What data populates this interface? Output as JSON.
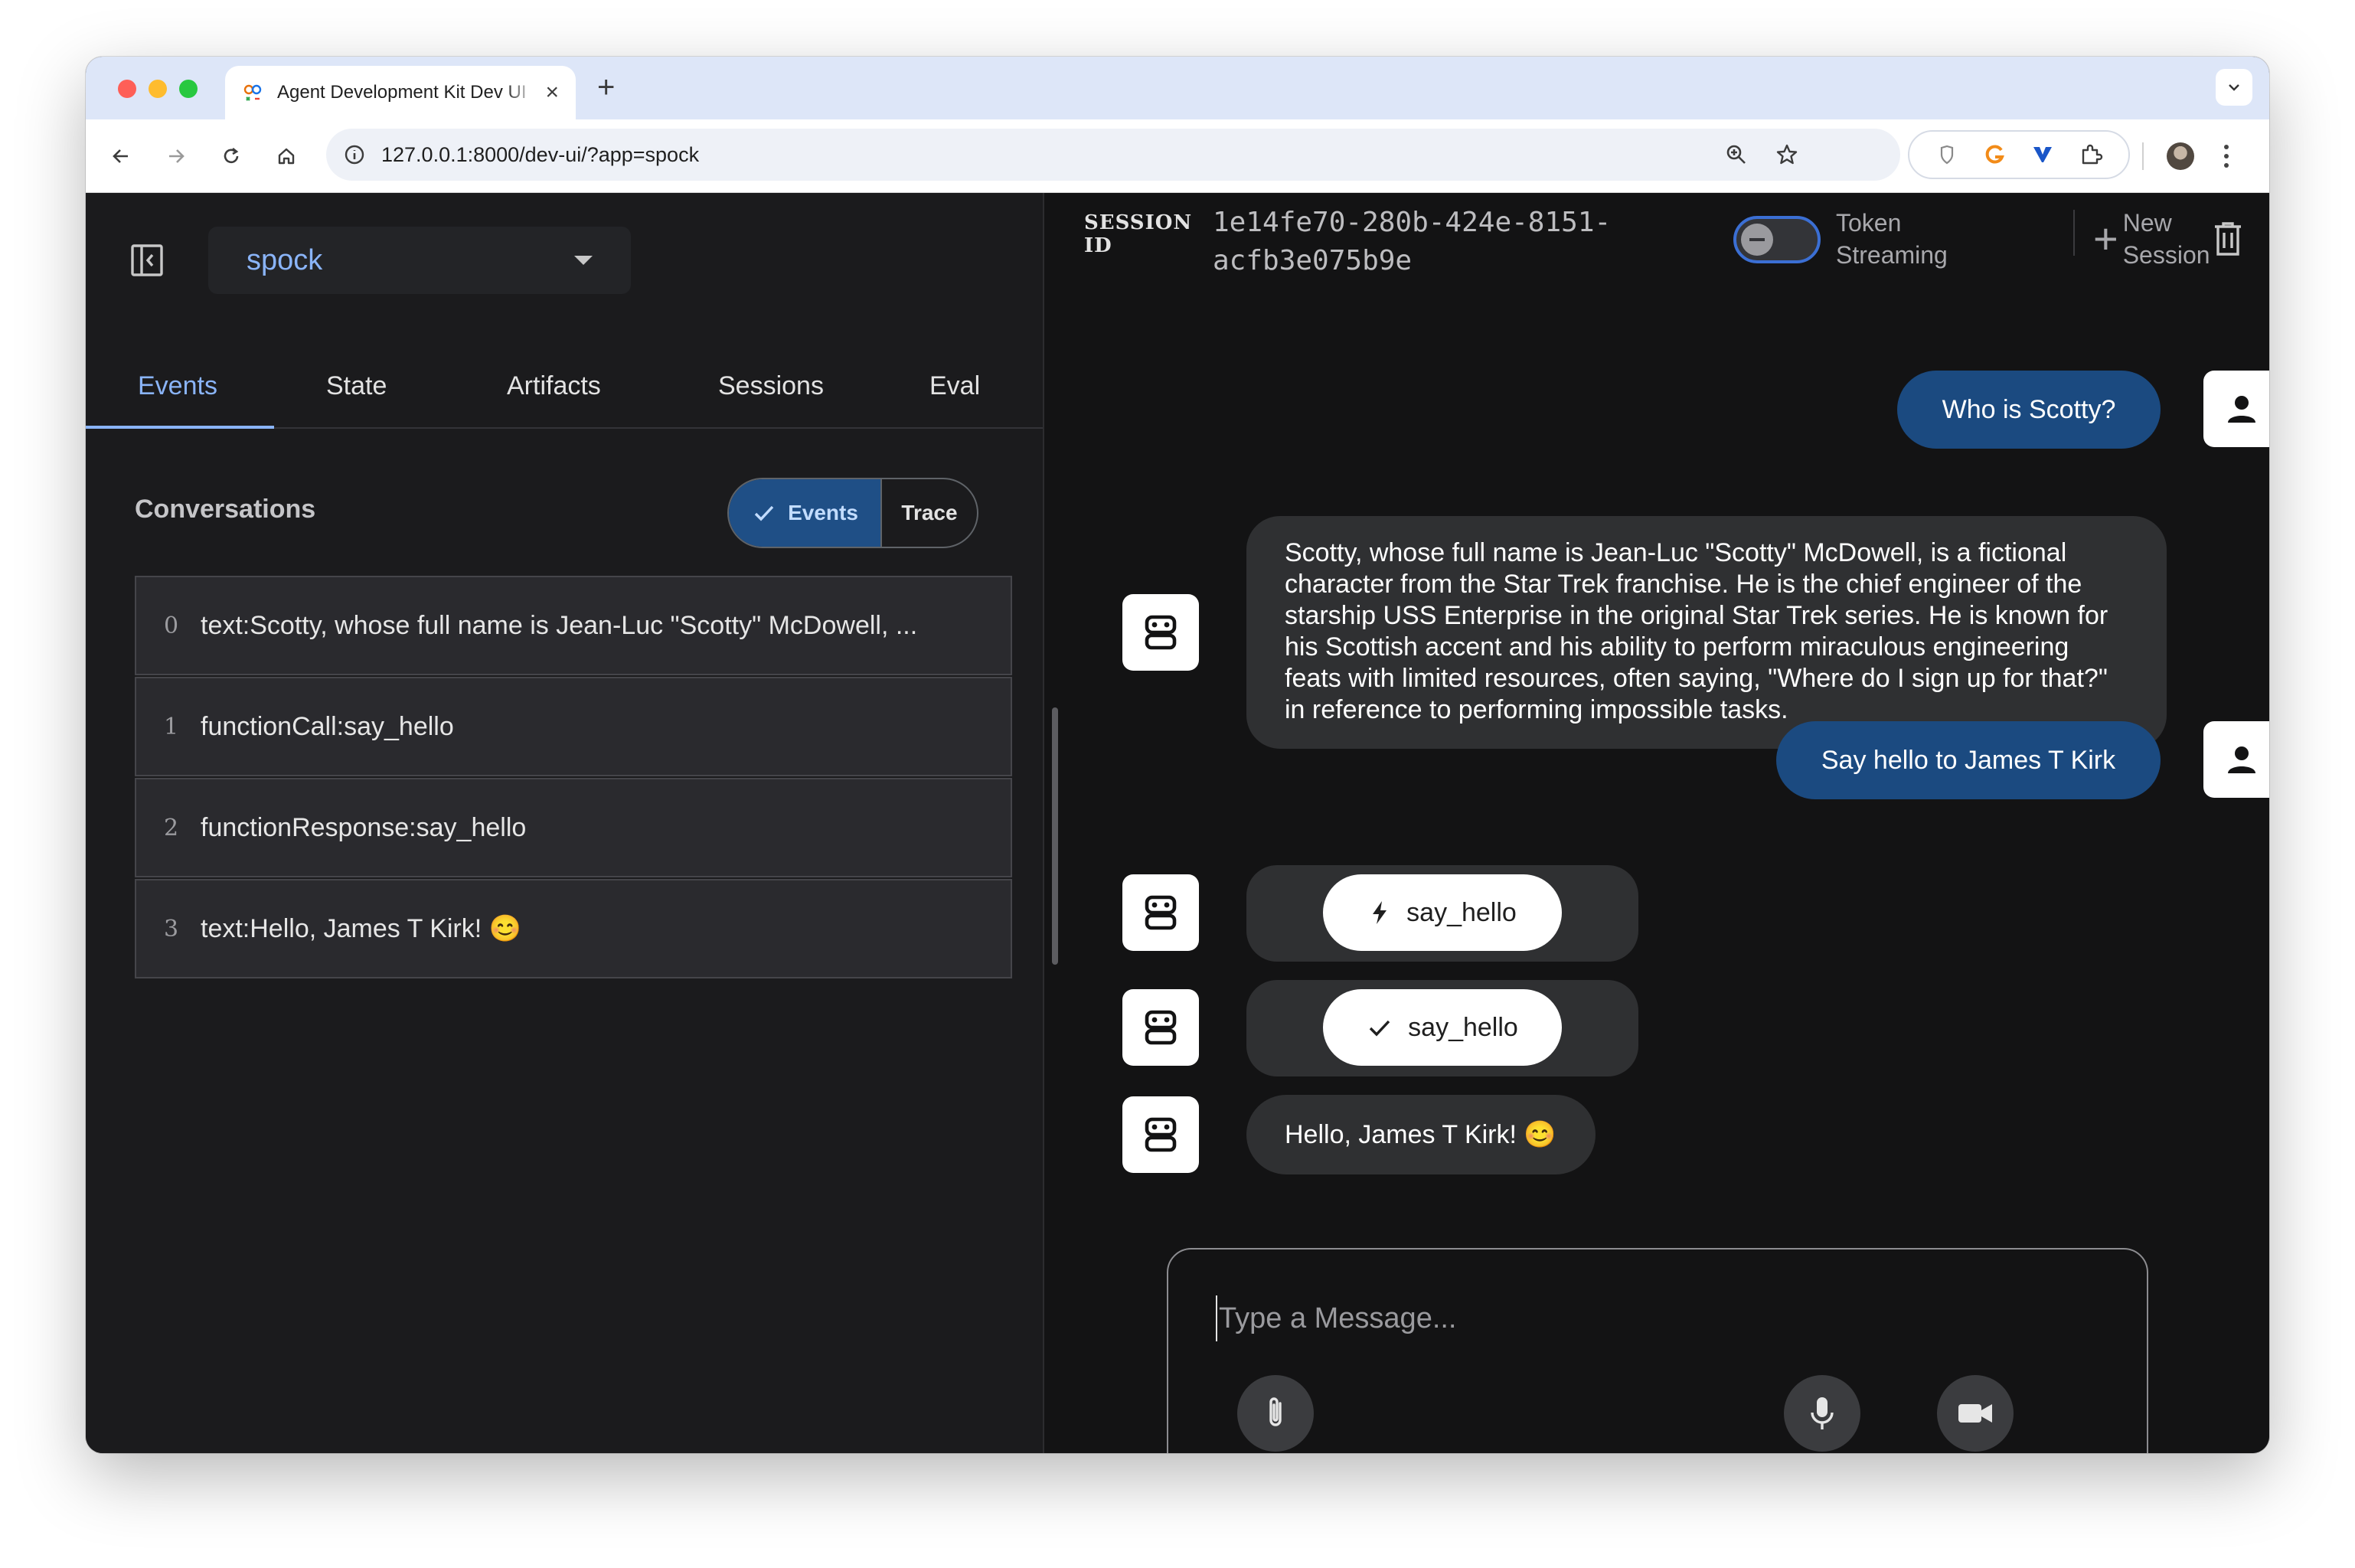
{
  "browser": {
    "tab_title": "Agent Development Kit Dev UI",
    "url": "127.0.0.1:8000/dev-ui/?app=spock"
  },
  "app": {
    "selected_app": "spock",
    "tabs": [
      {
        "label": "Events",
        "active": true
      },
      {
        "label": "State",
        "active": false
      },
      {
        "label": "Artifacts",
        "active": false
      },
      {
        "label": "Sessions",
        "active": false
      },
      {
        "label": "Eval",
        "active": false
      }
    ],
    "conversations_title": "Conversations",
    "view_toggle": {
      "events_label": "Events",
      "trace_label": "Trace",
      "selected": "Events"
    },
    "events": [
      {
        "index": "0",
        "text": "text:Scotty, whose full name is Jean-Luc \"Scotty\" McDowell, ..."
      },
      {
        "index": "1",
        "text": "functionCall:say_hello"
      },
      {
        "index": "2",
        "text": "functionResponse:say_hello"
      },
      {
        "index": "3",
        "text": "text:Hello, James T Kirk! 😊"
      }
    ]
  },
  "header": {
    "session_label_line1": "SESSION",
    "session_label_line2": "ID",
    "session_id_line1": "1e14fe70-280b-424e-8151-",
    "session_id_line2": "acfb3e075b9e",
    "token_streaming_line1": "Token",
    "token_streaming_line2": "Streaming",
    "token_streaming_on": false,
    "new_session_line1": "New",
    "new_session_line2": "Session"
  },
  "chat": {
    "messages": [
      {
        "role": "user",
        "text": "Who is Scotty?"
      },
      {
        "role": "bot",
        "text": "Scotty, whose full name is Jean-Luc \"Scotty\" McDowell, is a fictional character from the Star Trek franchise. He is the chief engineer of the starship USS Enterprise in the original Star Trek series. He is known for his Scottish accent and his ability to perform miraculous engineering feats with limited resources, often saying, \"Where do I sign up for that?\" in reference to performing impossible tasks."
      },
      {
        "role": "user",
        "text": "Say hello to James T Kirk"
      },
      {
        "role": "bot",
        "function_call": "say_hello"
      },
      {
        "role": "bot",
        "function_response": "say_hello"
      },
      {
        "role": "bot",
        "text": "Hello, James T Kirk! 😊"
      }
    ],
    "input_placeholder": "Type a Message..."
  },
  "colors": {
    "accent": "#8ab4f8",
    "user_bubble": "#1b4a80",
    "bot_bubble": "#2f3032",
    "panel_bg": "#1b1b1d",
    "chat_bg": "#131314"
  }
}
